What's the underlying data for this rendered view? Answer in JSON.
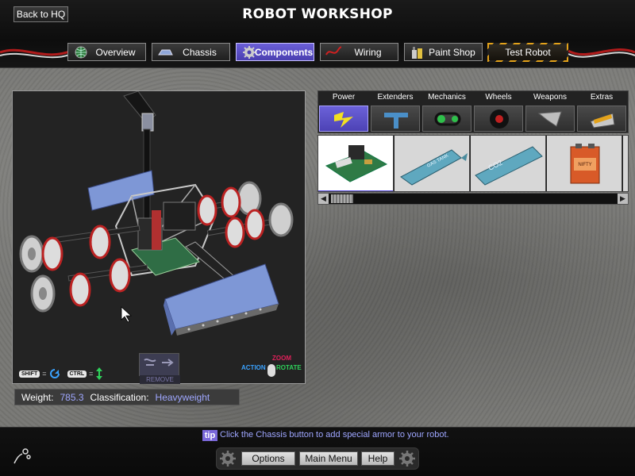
{
  "header": {
    "title": "ROBOT WORKSHOP",
    "back_label": "Back to HQ"
  },
  "tabs": [
    {
      "label": "Overview",
      "icon": "globe-icon"
    },
    {
      "label": "Chassis",
      "icon": "chassis-icon"
    },
    {
      "label": "Components",
      "icon": "gear-icon",
      "active": true
    },
    {
      "label": "Wiring",
      "icon": "wire-icon"
    },
    {
      "label": "Paint Shop",
      "icon": "paint-icon"
    },
    {
      "label": "Test Robot",
      "icon": "hazard-icon"
    }
  ],
  "viewport": {
    "shift_key": "SHIFT",
    "ctrl_key": "CTRL",
    "eq": "=",
    "remove_label": "REMOVE",
    "zoom_label": "ZOOM",
    "action_label": "ACTION",
    "rotate_label": "ROTATE"
  },
  "stats": {
    "weight_label": "Weight:",
    "weight_value": "785.3",
    "class_label": "Classification:",
    "class_value": "Heavyweight"
  },
  "categories": [
    {
      "label": "Power",
      "icon": "lightning-icon",
      "active": true
    },
    {
      "label": "Extenders",
      "icon": "extender-icon"
    },
    {
      "label": "Mechanics",
      "icon": "chain-icon"
    },
    {
      "label": "Wheels",
      "icon": "wheel-icon"
    },
    {
      "label": "Weapons",
      "icon": "blade-icon"
    },
    {
      "label": "Extras",
      "icon": "hazard-plate-icon"
    }
  ],
  "parts": [
    {
      "name": "circuit-board",
      "selected": true
    },
    {
      "name": "gas-tank",
      "text": "GAS TANK"
    },
    {
      "name": "co2-tank",
      "text": "CO2"
    },
    {
      "name": "battery",
      "text": "NIFTY"
    }
  ],
  "footer": {
    "tip_badge": "tip",
    "tip_text": "Click the Chassis button to add special armor to your robot.",
    "options_label": "Options",
    "main_menu_label": "Main Menu",
    "help_label": "Help"
  },
  "colors": {
    "accent": "#5a4fe0",
    "stat_value": "#9fa7ff",
    "zoom": "#e0205a",
    "action": "#3aa2ff",
    "rotate": "#2ed15a"
  }
}
